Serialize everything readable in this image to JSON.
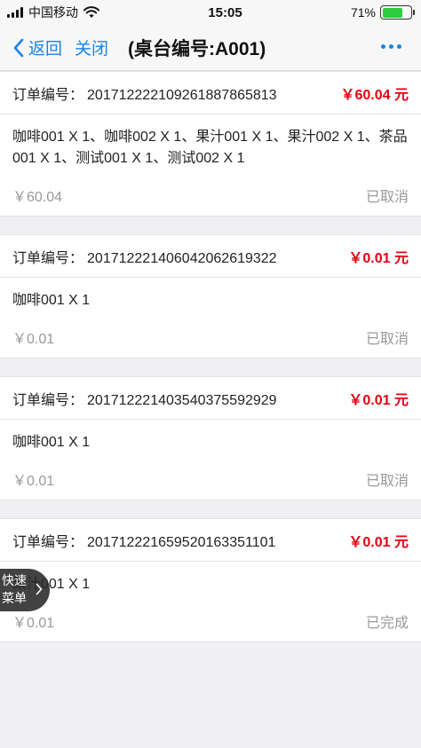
{
  "status_bar": {
    "carrier": "中国移动",
    "time": "15:05",
    "battery": "71%",
    "battery_level": 0.71
  },
  "nav": {
    "back_label": "返回",
    "close_label": "关闭",
    "title": "(桌台编号:A001)"
  },
  "order_no_label": "订单编号：",
  "orders": [
    {
      "order_no": "20171222210926188786581 3",
      "total": "￥60.04 元",
      "items": "咖啡001 X 1、咖啡002 X 1、果汁001 X 1、果汁002 X 1、茶品001 X 1、测试001 X 1、测试002 X 1",
      "amount": "￥60.04",
      "status": "已取消"
    },
    {
      "order_no": "20171222140604206261932 2",
      "total": "￥0.01 元",
      "items": "咖啡001 X 1",
      "amount": "￥0.01",
      "status": "已取消"
    },
    {
      "order_no": "20171222140354037559292 9",
      "total": "￥0.01 元",
      "items": "咖啡001 X 1",
      "amount": "￥0.01",
      "status": "已取消"
    },
    {
      "order_no": "20171222165952016335110 1",
      "total": "￥0.01 元",
      "items": "果汁001 X 1",
      "amount": "￥0.01",
      "status": "已完成"
    }
  ],
  "quick_menu": {
    "line1": "快速",
    "line2": "菜单"
  },
  "colors": {
    "accent": "#1b82e6",
    "price": "#e60012",
    "muted": "#999999"
  }
}
